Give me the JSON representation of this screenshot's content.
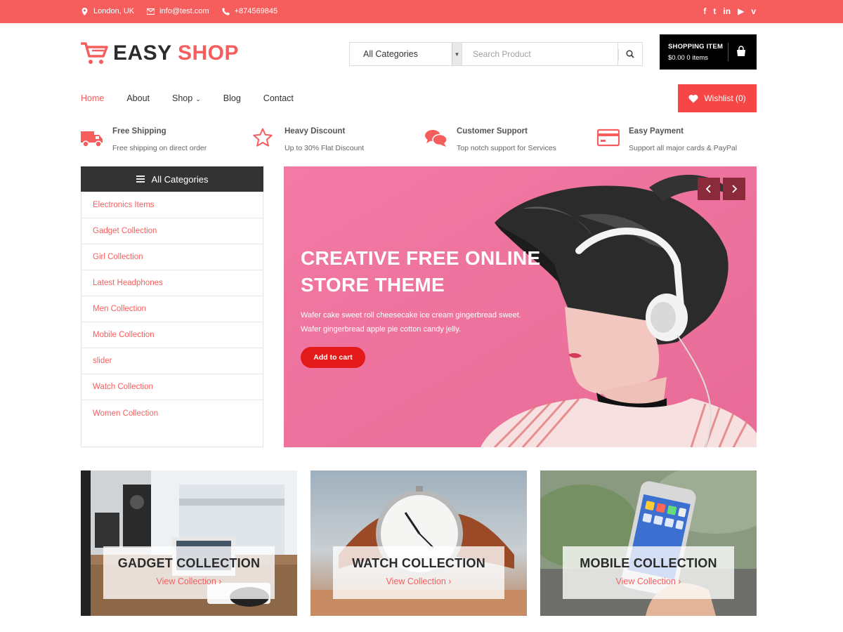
{
  "topbar": {
    "location": "London, UK",
    "email": "info@test.com",
    "phone": "+874569845",
    "social": [
      {
        "icon": "facebook-icon",
        "glyph": "f"
      },
      {
        "icon": "twitter-icon",
        "glyph": "t"
      },
      {
        "icon": "linkedin-icon",
        "glyph": "in"
      },
      {
        "icon": "youtube-icon",
        "glyph": "▶"
      },
      {
        "icon": "vimeo-icon",
        "glyph": "v"
      }
    ]
  },
  "header": {
    "logo_dark": "EASY",
    "logo_red": "SHOP",
    "category_select": "All Categories",
    "search_placeholder": "Search Product",
    "cart_title": "SHOPPING ITEM",
    "cart_summary": "$0.00 0 items"
  },
  "nav": {
    "items": [
      "Home",
      "About",
      "Shop",
      "Blog",
      "Contact"
    ],
    "wishlist": "Wishlist (0)"
  },
  "features": [
    {
      "title": "Free Shipping",
      "subtitle": "Free shipping on direct order",
      "icon": "truck-icon"
    },
    {
      "title": "Heavy Discount",
      "subtitle": "Up to 30% Flat Discount",
      "icon": "star-icon"
    },
    {
      "title": "Customer Support",
      "subtitle": "Top notch support for Services",
      "icon": "chat-icon"
    },
    {
      "title": "Easy Payment",
      "subtitle": "Support all major cards & PayPal",
      "icon": "credit-card-icon"
    }
  ],
  "sidebar": {
    "header": "All Categories",
    "items": [
      "Electronics Items",
      "Gadget Collection",
      "Girl Collection",
      "Latest Headphones",
      "Men Collection",
      "Mobile Collection",
      "slider",
      "Watch Collection",
      "Women Collection"
    ]
  },
  "hero": {
    "title_line1": "CREATIVE FREE ONLINE",
    "title_line2": "STORE THEME",
    "desc_line1": "Wafer cake sweet roll cheesecake ice cream gingerbread sweet.",
    "desc_line2": "Wafer gingerbread apple pie cotton candy jelly.",
    "cta": "Add to cart"
  },
  "collections": [
    {
      "title": "GADGET COLLECTION",
      "link": "View Collection"
    },
    {
      "title": "WATCH COLLECTION",
      "link": "View Collection"
    },
    {
      "title": "MOBILE COLLECTION",
      "link": "View Collection"
    }
  ],
  "colors": {
    "accent": "#f65e5e",
    "dark": "#333333",
    "cart_bg": "#000000",
    "wishlist_bg": "#f64646",
    "hero_bg": "#ef7aa0",
    "cta_bg": "#e41a1a"
  }
}
